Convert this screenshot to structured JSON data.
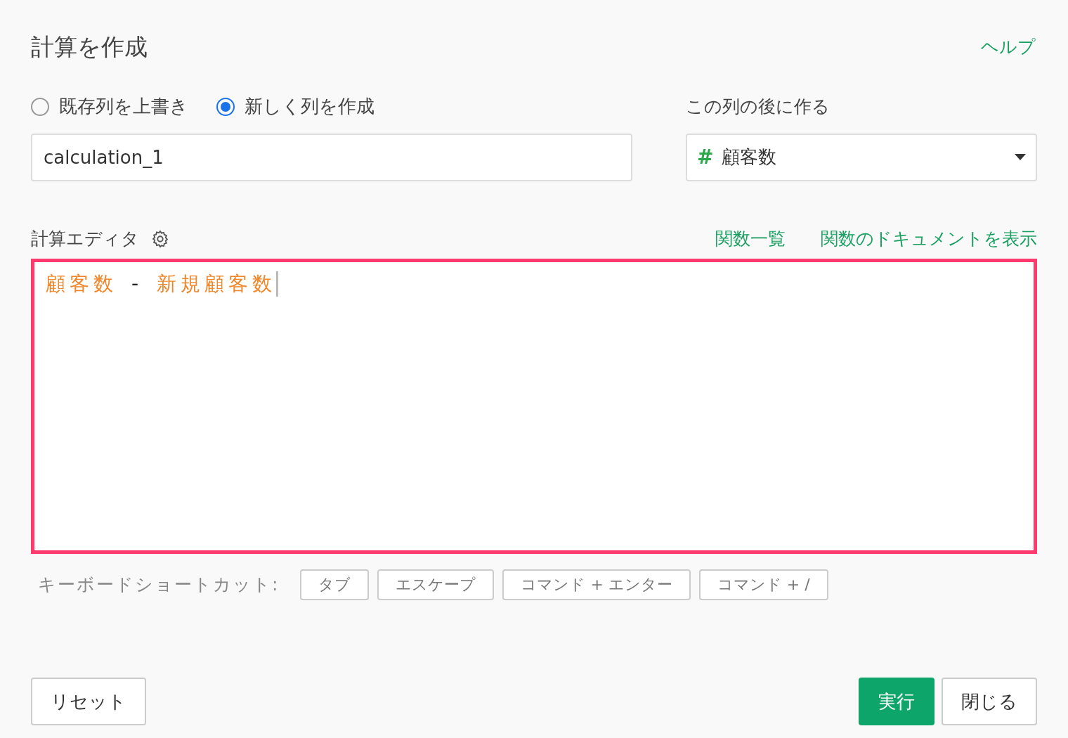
{
  "title": "計算を作成",
  "help_link": "ヘルプ",
  "mode_options": [
    {
      "label": "既存列を上書き",
      "selected": false
    },
    {
      "label": "新しく列を作成",
      "selected": true
    }
  ],
  "column_name": {
    "value": "calculation_1"
  },
  "position": {
    "label": "この列の後に作る",
    "type_symbol": "#",
    "value": "顧客数"
  },
  "editor": {
    "label": "計算エディタ",
    "links": [
      "関数一覧",
      "関数のドキュメントを表示"
    ],
    "tokens": [
      {
        "kind": "column",
        "text": "顧客数"
      },
      {
        "kind": "operator",
        "text": "-"
      },
      {
        "kind": "column",
        "text": "新規顧客数"
      }
    ]
  },
  "shortcuts": {
    "label": "キーボードショートカット:",
    "keys": [
      "タブ",
      "エスケープ",
      "コマンド + エンター",
      "コマンド + /"
    ]
  },
  "buttons": {
    "reset": "リセット",
    "run": "実行",
    "close": "閉じる"
  }
}
